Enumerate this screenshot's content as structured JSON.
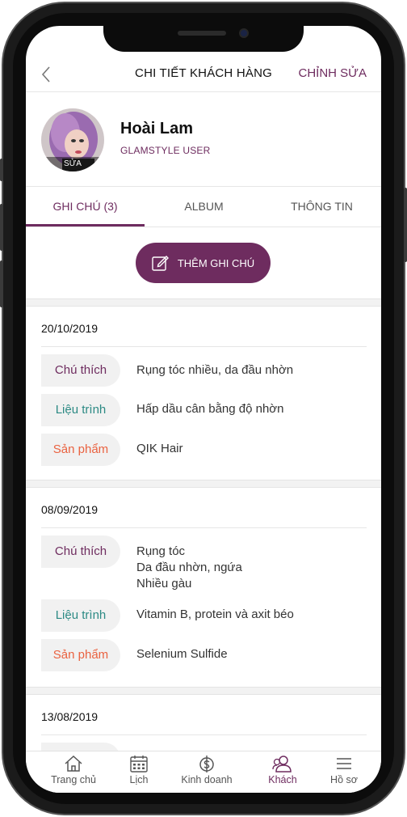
{
  "header": {
    "title": "CHI TIẾT KHÁCH HÀNG",
    "edit_label": "CHỈNH SỬA"
  },
  "profile": {
    "name": "Hoài Lam",
    "role": "GLAMSTYLE USER",
    "avatar_edit_label": "SỬA"
  },
  "tabs": [
    {
      "label": "GHI CHÚ (3)",
      "active": true
    },
    {
      "label": "ALBUM",
      "active": false
    },
    {
      "label": "THÔNG TIN",
      "active": false
    }
  ],
  "add_note_label": "THÊM GHI CHÚ",
  "notes": [
    {
      "date": "20/10/2019",
      "note_label": "Chú thích",
      "note_lines": [
        "Rụng tóc nhiều, da đầu nhờn"
      ],
      "treatment_label": "Liệu trình",
      "treatment": "Hấp dầu cân bằng độ nhờn",
      "product_label": "Sản phẩm",
      "product": "QIK Hair"
    },
    {
      "date": "08/09/2019",
      "note_label": "Chú thích",
      "note_lines": [
        "Rụng tóc",
        "Da đầu nhờn, ngứa",
        "Nhiều gàu"
      ],
      "treatment_label": "Liệu trình",
      "treatment": "Vitamin B, protein và axit béo",
      "product_label": "Sản phẩm",
      "product": "Selenium Sulfide"
    },
    {
      "date": "13/08/2019"
    }
  ],
  "tabbar": [
    {
      "label": "Trang chủ",
      "icon": "home-icon",
      "active": false
    },
    {
      "label": "Lịch",
      "icon": "calendar-icon",
      "active": false
    },
    {
      "label": "Kinh doanh",
      "icon": "dollar-icon",
      "active": false
    },
    {
      "label": "Khách",
      "icon": "customers-icon",
      "active": true
    },
    {
      "label": "Hồ sơ",
      "icon": "menu-icon",
      "active": false
    }
  ],
  "colors": {
    "accent": "#6e2c5f",
    "note": "#6e2c5f",
    "treatment": "#2c8a84",
    "product": "#ea6240"
  }
}
